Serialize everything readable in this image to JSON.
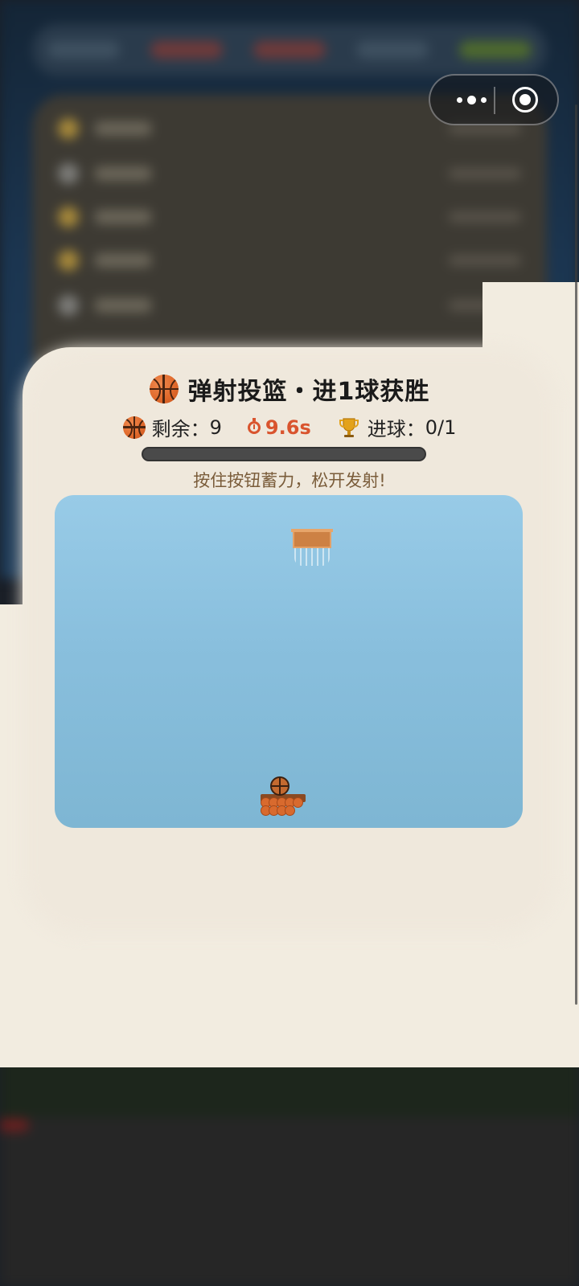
{
  "capsule": {
    "more_icon": "more-dots-icon",
    "close_icon": "target-circle-icon"
  },
  "game": {
    "title": "弹射投篮・进1球获胜",
    "stats": {
      "remaining_label": "剩余：",
      "remaining_value": "9",
      "timer": "9.6s",
      "goals_label": "进球：",
      "goals_value": "0/1"
    },
    "power_level": 0,
    "hint": "按住按钮蓄力，松开发射!",
    "colors": {
      "court_top": "#98cbe7",
      "court_bottom": "#7eb6d3",
      "panel_bg": "#f2ece0",
      "timer_color": "#d9542e",
      "power_bar_bg": "#4a4a4a"
    },
    "icons": {
      "title_icon": "basketball-icon",
      "remaining_icon": "basketball-icon",
      "timer_icon": "stopwatch-icon",
      "goals_icon": "trophy-icon"
    }
  }
}
